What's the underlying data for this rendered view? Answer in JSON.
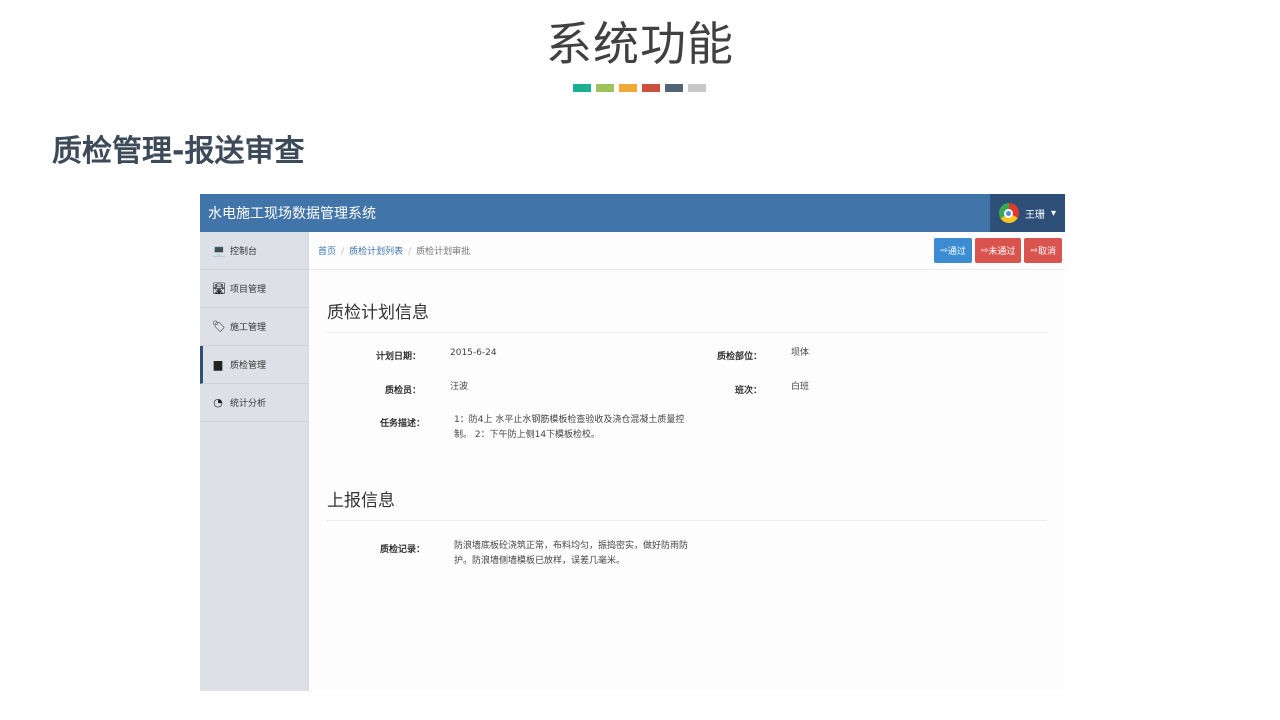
{
  "slide": {
    "title": "系统功能",
    "section_heading": "质检管理-报送审查",
    "accent_colors": [
      "#1aae94",
      "#a0c25a",
      "#f2a93b",
      "#cf4f3e",
      "#4f6478",
      "#c8c8c8"
    ]
  },
  "app": {
    "brand": "水电施工现场数据管理系统",
    "user": {
      "name": "王珊",
      "caret": "▾",
      "avatar_icon": "chrome-avatar"
    },
    "sidebar": [
      {
        "icon": "laptop-icon",
        "glyph": "💻",
        "label": "控制台"
      },
      {
        "icon": "road-icon",
        "glyph": "🛣",
        "label": "项目管理"
      },
      {
        "icon": "tags-icon",
        "glyph": "🏷",
        "label": "施工管理"
      },
      {
        "icon": "folder-icon",
        "glyph": "▆",
        "label": "质检管理",
        "active": true
      },
      {
        "icon": "dashboard-icon",
        "glyph": "◔",
        "label": "统计分析"
      }
    ],
    "breadcrumb": {
      "home": "首页",
      "list": "质检计划列表",
      "current": "质检计划审批",
      "sep": "/"
    },
    "buttons": {
      "pass": "通过",
      "fail": "未通过",
      "cancel": "取消",
      "icon": "⇨"
    },
    "plan": {
      "title": "质检计划信息",
      "plan_date_label": "计划日期：",
      "plan_date": "2015-6-24",
      "part_label": "质检部位：",
      "part": "坝体",
      "inspector_label": "质检员：",
      "inspector": "汪波",
      "shift_label": "班次：",
      "shift": "白班",
      "task_label": "任务描述：",
      "task_line1": "1：防4上 水平止水钢筋模板检查验收及浇仓混凝土质量控",
      "task_line2": "制。 2：下午防上侧14下模板检校。"
    },
    "report": {
      "title": "上报信息",
      "record_label": "质检记录：",
      "record_line1": "防浪墙底板砼浇筑正常，布料均匀，振捣密实，做好防雨防",
      "record_line2": "护。防浪墙侧墙模板已放样，误差几毫米。"
    }
  }
}
